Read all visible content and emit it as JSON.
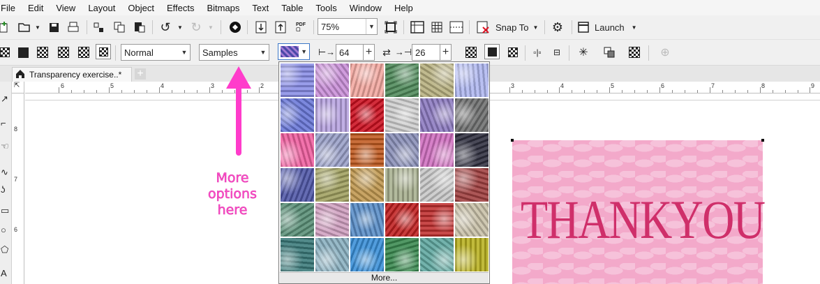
{
  "menu": [
    "File",
    "Edit",
    "View",
    "Layout",
    "Object",
    "Effects",
    "Bitmaps",
    "Text",
    "Table",
    "Tools",
    "Window",
    "Help"
  ],
  "toolbar": {
    "zoom": "75%",
    "snap_to": "Snap To",
    "launch": "Launch"
  },
  "property_bar": {
    "merge_mode": "Normal",
    "library": "Samples",
    "width": "64",
    "height": "26"
  },
  "document": {
    "tab_title": "Transparency exercise..*"
  },
  "rulers": {
    "h_left": [
      "6",
      "5",
      "4",
      "3",
      "2"
    ],
    "h_right": [
      "3",
      "4",
      "5",
      "6",
      "7",
      "8",
      "9"
    ],
    "v": [
      "8",
      "7",
      "6"
    ]
  },
  "gallery": {
    "more_label": "More...",
    "swatches": [
      [
        "#8a8ee6",
        "#c990d8",
        "#f3a8a0",
        "#4f8a5a",
        "#b7b080",
        "#b0b8f0"
      ],
      [
        "#6a78d8",
        "#b8a4e0",
        "#cc1020",
        "#cfcfcf",
        "#8c7ac0",
        "#6f7070"
      ],
      [
        "#f060a0",
        "#9aa0c8",
        "#c05a20",
        "#8a90b8",
        "#d070c0",
        "#303040"
      ],
      [
        "#5058a8",
        "#a0a060",
        "#c09850",
        "#a8b090",
        "#c8c8c8",
        "#a04040"
      ],
      [
        "#5a9078",
        "#d0a0c0",
        "#5a8ec8",
        "#c02020",
        "#c03030",
        "#c8c0a8"
      ],
      [
        "#3a7a7a",
        "#8ab0c0",
        "#3a90d8",
        "#3a8a50",
        "#60a8a0",
        "#b8b020"
      ]
    ]
  },
  "card": {
    "text": "THANKYOU"
  },
  "annotation": {
    "text": "More options here",
    "color": "#ff4fc9"
  }
}
